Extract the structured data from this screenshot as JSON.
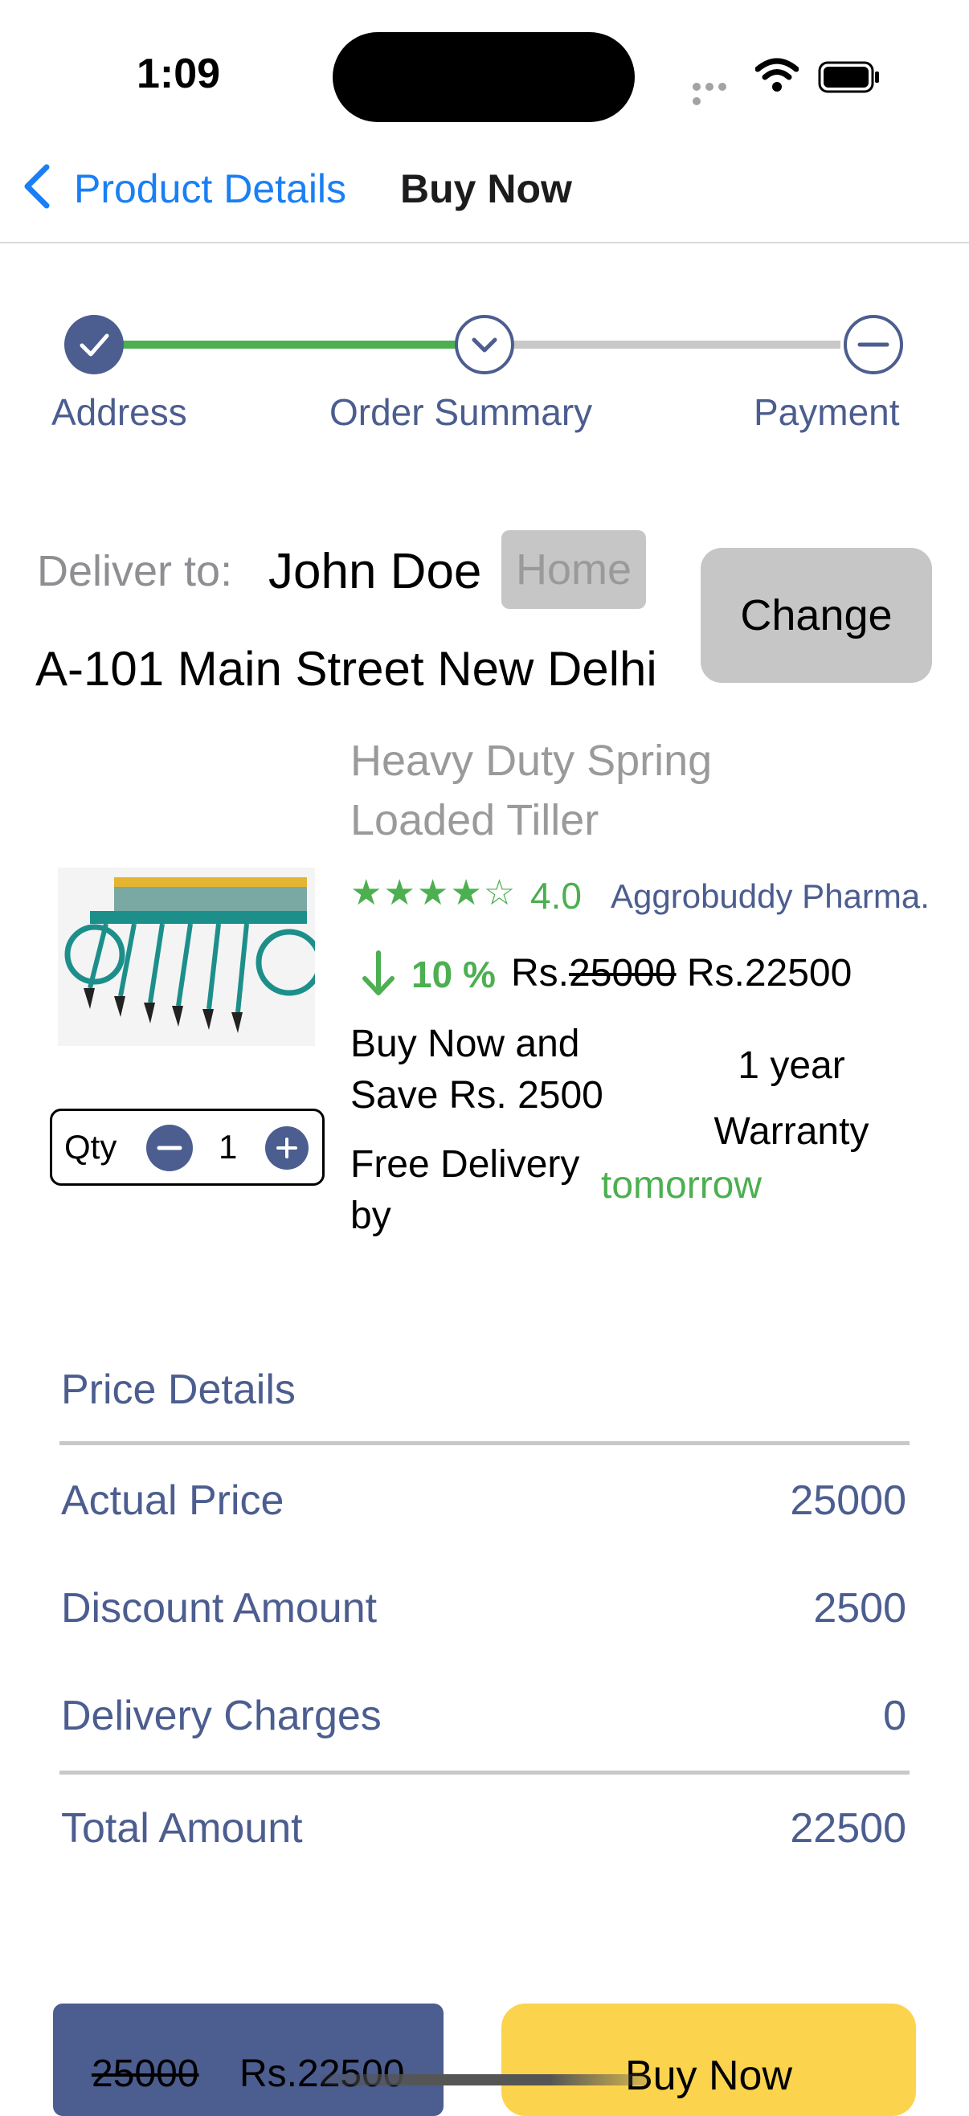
{
  "status_bar": {
    "time": "1:09"
  },
  "nav": {
    "back_label": "Product Details",
    "title": "Buy Now"
  },
  "stepper": {
    "steps": [
      {
        "label": "Address",
        "state": "done"
      },
      {
        "label": "Order Summary",
        "state": "current"
      },
      {
        "label": "Payment",
        "state": "pending"
      }
    ]
  },
  "delivery": {
    "label": "Deliver to:",
    "name": "John Doe",
    "badge": "Home",
    "change_label": "Change",
    "address": "A-101 Main Street New Delhi"
  },
  "product": {
    "title": "Heavy Duty Spring Loaded Tiller",
    "stars": "★★★★☆",
    "rating": "4.0",
    "rating_value": 4.0,
    "seller": "Aggrobuddy Pharma.",
    "discount": "10 %",
    "price_prefix": "Rs.",
    "original_price": "25000",
    "final_price": "Rs.22500",
    "save_text": "Buy Now and Save Rs. 2500",
    "warranty_line1": "1 year",
    "warranty_line2": "Warranty",
    "free_delivery": "Free Delivery by",
    "delivery_day": "tomorrow",
    "qty_label": "Qty",
    "qty_value": "1",
    "image_name": "seed-drill-tiller-image"
  },
  "price_details": {
    "title": "Price Details",
    "rows": [
      {
        "label": "Actual Price",
        "value": "25000"
      },
      {
        "label": "Discount Amount",
        "value": "2500"
      },
      {
        "label": "Delivery Charges",
        "value": "0"
      }
    ],
    "total_label": "Total Amount",
    "total_value": "22500"
  },
  "bottom_bar": {
    "old_price": "25000",
    "new_price": "Rs.22500",
    "buy_label": "Buy Now"
  },
  "colors": {
    "accent_blue": "#4c5d8f",
    "ios_blue": "#1a7ff5",
    "green": "#4caf50",
    "buy_yellow": "#fcd34d",
    "grey_button": "#c6c6c6"
  }
}
